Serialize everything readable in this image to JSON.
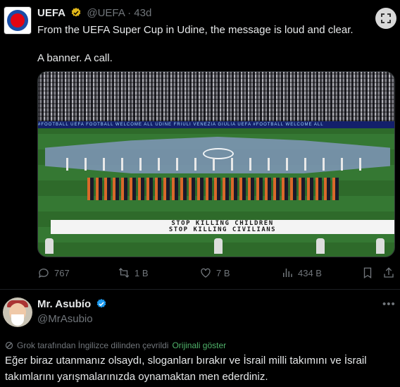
{
  "post": {
    "author_name": "UEFA",
    "handle": "@UEFA",
    "separator": "·",
    "age": "43d",
    "text_line1": "From the UEFA Super Cup in Udine, the message is loud and clear.",
    "text_line2": "A banner. A call.",
    "media": {
      "adboard_text": "#FOOTBALL   UEFA   FOOTBALL   WELCOME ALL   UDINE FRIULI VENEZIA GIULIA   UEFA   #FOOTBALL   WELCOME ALL",
      "banner_line1": "STOP KILLING CHILDREN",
      "banner_line2": "STOP KILLING CIVILIANS"
    },
    "stats": {
      "replies": "767",
      "reposts": "1 B",
      "likes": "7 B",
      "views": "434 B"
    }
  },
  "reply": {
    "author_name": "Mr. Asubío",
    "handle": "@MrAsubio",
    "more_label": "•••",
    "translate_notice": "Grok tarafından İngilizce dilinden çevrildi",
    "show_original": "Orijinali göster",
    "text": "Eğer biraz utanmanız olsaydı, sloganları bırakır ve İsrail milli takımını ve İsrail takımlarını yarışmalarınızda oynamaktan men ederdiniz."
  },
  "colors": {
    "background": "#000000",
    "text": "#e7e9ea",
    "muted": "#71767b",
    "verified_gold": "#e2b719",
    "verified_blue": "#1d9bf0",
    "show_original_link": "#4fb26a"
  }
}
